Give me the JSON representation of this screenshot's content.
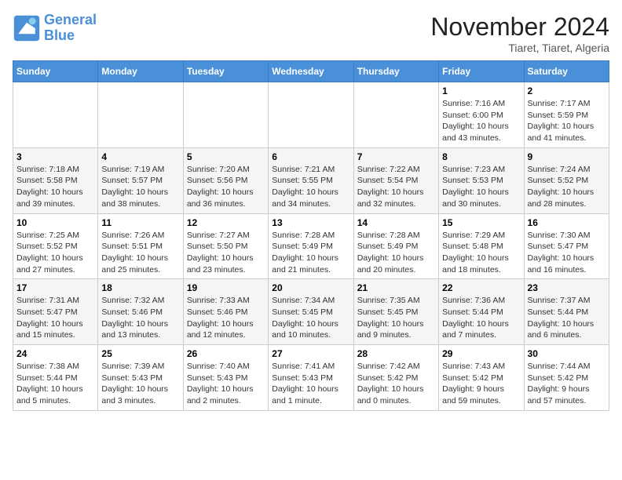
{
  "logo": {
    "line1": "General",
    "line2": "Blue"
  },
  "title": "November 2024",
  "subtitle": "Tiaret, Tiaret, Algeria",
  "weekdays": [
    "Sunday",
    "Monday",
    "Tuesday",
    "Wednesday",
    "Thursday",
    "Friday",
    "Saturday"
  ],
  "weeks": [
    [
      {
        "day": "",
        "info": ""
      },
      {
        "day": "",
        "info": ""
      },
      {
        "day": "",
        "info": ""
      },
      {
        "day": "",
        "info": ""
      },
      {
        "day": "",
        "info": ""
      },
      {
        "day": "1",
        "info": "Sunrise: 7:16 AM\nSunset: 6:00 PM\nDaylight: 10 hours\nand 43 minutes."
      },
      {
        "day": "2",
        "info": "Sunrise: 7:17 AM\nSunset: 5:59 PM\nDaylight: 10 hours\nand 41 minutes."
      }
    ],
    [
      {
        "day": "3",
        "info": "Sunrise: 7:18 AM\nSunset: 5:58 PM\nDaylight: 10 hours\nand 39 minutes."
      },
      {
        "day": "4",
        "info": "Sunrise: 7:19 AM\nSunset: 5:57 PM\nDaylight: 10 hours\nand 38 minutes."
      },
      {
        "day": "5",
        "info": "Sunrise: 7:20 AM\nSunset: 5:56 PM\nDaylight: 10 hours\nand 36 minutes."
      },
      {
        "day": "6",
        "info": "Sunrise: 7:21 AM\nSunset: 5:55 PM\nDaylight: 10 hours\nand 34 minutes."
      },
      {
        "day": "7",
        "info": "Sunrise: 7:22 AM\nSunset: 5:54 PM\nDaylight: 10 hours\nand 32 minutes."
      },
      {
        "day": "8",
        "info": "Sunrise: 7:23 AM\nSunset: 5:53 PM\nDaylight: 10 hours\nand 30 minutes."
      },
      {
        "day": "9",
        "info": "Sunrise: 7:24 AM\nSunset: 5:52 PM\nDaylight: 10 hours\nand 28 minutes."
      }
    ],
    [
      {
        "day": "10",
        "info": "Sunrise: 7:25 AM\nSunset: 5:52 PM\nDaylight: 10 hours\nand 27 minutes."
      },
      {
        "day": "11",
        "info": "Sunrise: 7:26 AM\nSunset: 5:51 PM\nDaylight: 10 hours\nand 25 minutes."
      },
      {
        "day": "12",
        "info": "Sunrise: 7:27 AM\nSunset: 5:50 PM\nDaylight: 10 hours\nand 23 minutes."
      },
      {
        "day": "13",
        "info": "Sunrise: 7:28 AM\nSunset: 5:49 PM\nDaylight: 10 hours\nand 21 minutes."
      },
      {
        "day": "14",
        "info": "Sunrise: 7:28 AM\nSunset: 5:49 PM\nDaylight: 10 hours\nand 20 minutes."
      },
      {
        "day": "15",
        "info": "Sunrise: 7:29 AM\nSunset: 5:48 PM\nDaylight: 10 hours\nand 18 minutes."
      },
      {
        "day": "16",
        "info": "Sunrise: 7:30 AM\nSunset: 5:47 PM\nDaylight: 10 hours\nand 16 minutes."
      }
    ],
    [
      {
        "day": "17",
        "info": "Sunrise: 7:31 AM\nSunset: 5:47 PM\nDaylight: 10 hours\nand 15 minutes."
      },
      {
        "day": "18",
        "info": "Sunrise: 7:32 AM\nSunset: 5:46 PM\nDaylight: 10 hours\nand 13 minutes."
      },
      {
        "day": "19",
        "info": "Sunrise: 7:33 AM\nSunset: 5:46 PM\nDaylight: 10 hours\nand 12 minutes."
      },
      {
        "day": "20",
        "info": "Sunrise: 7:34 AM\nSunset: 5:45 PM\nDaylight: 10 hours\nand 10 minutes."
      },
      {
        "day": "21",
        "info": "Sunrise: 7:35 AM\nSunset: 5:45 PM\nDaylight: 10 hours\nand 9 minutes."
      },
      {
        "day": "22",
        "info": "Sunrise: 7:36 AM\nSunset: 5:44 PM\nDaylight: 10 hours\nand 7 minutes."
      },
      {
        "day": "23",
        "info": "Sunrise: 7:37 AM\nSunset: 5:44 PM\nDaylight: 10 hours\nand 6 minutes."
      }
    ],
    [
      {
        "day": "24",
        "info": "Sunrise: 7:38 AM\nSunset: 5:44 PM\nDaylight: 10 hours\nand 5 minutes."
      },
      {
        "day": "25",
        "info": "Sunrise: 7:39 AM\nSunset: 5:43 PM\nDaylight: 10 hours\nand 3 minutes."
      },
      {
        "day": "26",
        "info": "Sunrise: 7:40 AM\nSunset: 5:43 PM\nDaylight: 10 hours\nand 2 minutes."
      },
      {
        "day": "27",
        "info": "Sunrise: 7:41 AM\nSunset: 5:43 PM\nDaylight: 10 hours\nand 1 minute."
      },
      {
        "day": "28",
        "info": "Sunrise: 7:42 AM\nSunset: 5:42 PM\nDaylight: 10 hours\nand 0 minutes."
      },
      {
        "day": "29",
        "info": "Sunrise: 7:43 AM\nSunset: 5:42 PM\nDaylight: 9 hours\nand 59 minutes."
      },
      {
        "day": "30",
        "info": "Sunrise: 7:44 AM\nSunset: 5:42 PM\nDaylight: 9 hours\nand 57 minutes."
      }
    ]
  ]
}
